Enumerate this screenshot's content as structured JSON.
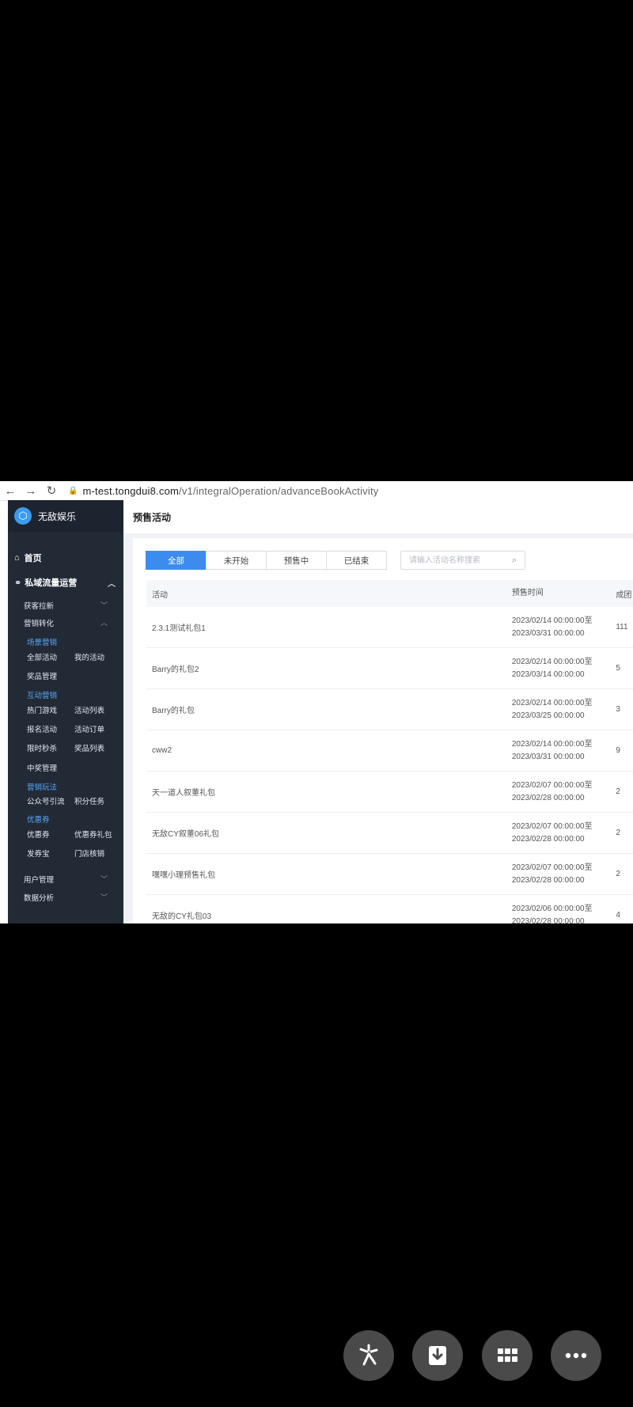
{
  "browser": {
    "back": "←",
    "forward": "→",
    "reload": "↻",
    "url_host": "m-test.tongdui8.com",
    "url_path": "/v1/integralOperation/advanceBookActivity"
  },
  "sidebar": {
    "brand": "无敌娱乐",
    "home": "首页",
    "group": "私域流量运营",
    "sub1": "获客拉新",
    "sub2": "营销转化",
    "scene_head": "场景营销",
    "all_activity": "全部活动",
    "my_activity": "我的活动",
    "prize_mgmt": "奖品管理",
    "interactive_head": "互动营销",
    "hot_games": "热门游戏",
    "activity_list": "活动列表",
    "signup": "报名活动",
    "orders": "活动订单",
    "flash_sale": "限时秒杀",
    "prize_list": "奖品列表",
    "winner_mgmt": "中奖管理",
    "marketing_head": "营销玩法",
    "official_account": "公众号引流",
    "points_task": "积分任务",
    "coupon_head": "优惠券",
    "coupon": "优惠券",
    "coupon_pack": "优惠券礼包",
    "fajuanbao": "发券宝",
    "store_verify": "门店核销",
    "user_mgmt": "用户管理",
    "data_analysis": "数据分析"
  },
  "page": {
    "title": "预售活动",
    "tabs": [
      "全部",
      "未开始",
      "预售中",
      "已结束"
    ],
    "search_placeholder": "请输入活动名称搜索",
    "columns": [
      "活动",
      "预售时间",
      "成团"
    ],
    "rows": [
      {
        "name": "2.3.1测试礼包1",
        "start": "2023/02/14 00:00:00至",
        "end": "2023/03/31 00:00:00",
        "count": "111"
      },
      {
        "name": "Barry的礼包2",
        "start": "2023/02/14 00:00:00至",
        "end": "2023/03/14 00:00:00",
        "count": "5"
      },
      {
        "name": "Barry的礼包",
        "start": "2023/02/14 00:00:00至",
        "end": "2023/03/25 00:00:00",
        "count": "3"
      },
      {
        "name": "cww2",
        "start": "2023/02/14 00:00:00至",
        "end": "2023/03/31 00:00:00",
        "count": "9"
      },
      {
        "name": "天一道人叙董礼包",
        "start": "2023/02/07 00:00:00至",
        "end": "2023/02/28 00:00:00",
        "count": "2"
      },
      {
        "name": "无敌CY叙董06礼包",
        "start": "2023/02/07 00:00:00至",
        "end": "2023/02/28 00:00:00",
        "count": "2"
      },
      {
        "name": "嘿嘿小理预售礼包",
        "start": "2023/02/07 00:00:00至",
        "end": "2023/02/28 00:00:00",
        "count": "2"
      },
      {
        "name": "无敌的CY礼包03",
        "start": "2023/02/06 00:00:00至",
        "end": "2023/02/28 00:00:00",
        "count": "4"
      }
    ]
  },
  "actions": {
    "share_icon": "share-icon",
    "download_icon": "download-icon",
    "grid_icon": "grid-icon",
    "more_icon": "more-icon"
  }
}
